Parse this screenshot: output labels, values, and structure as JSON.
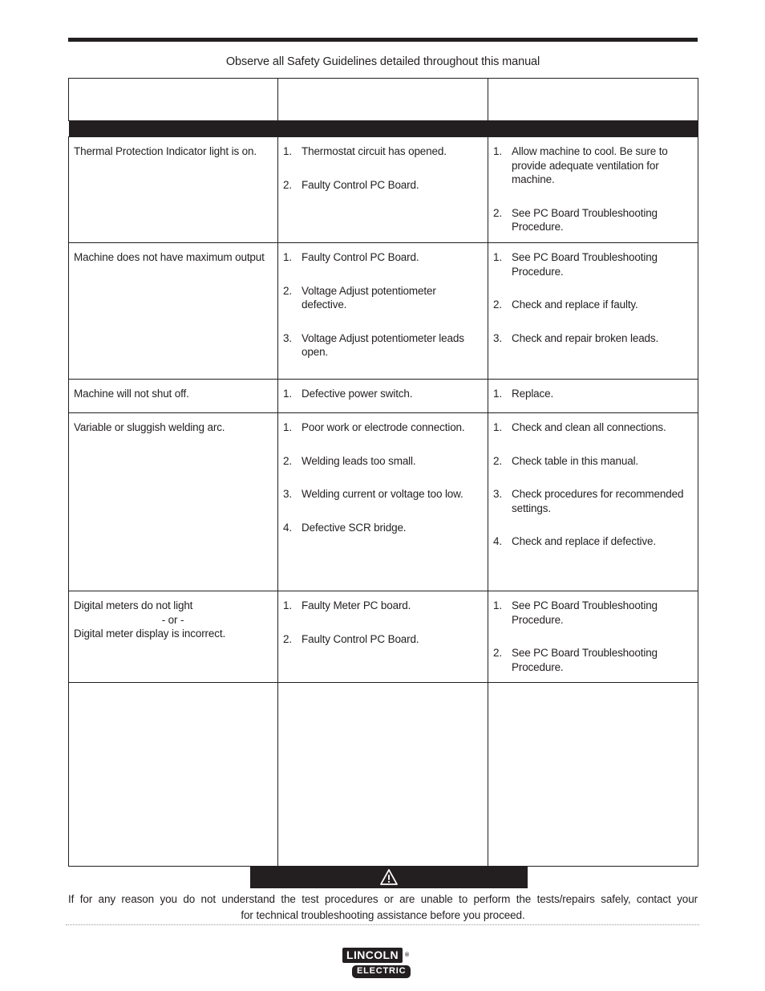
{
  "header": {
    "safety_note": "Observe all Safety Guidelines detailed throughout this manual"
  },
  "table": {
    "column_headers": [
      "",
      "",
      ""
    ],
    "rows": [
      {
        "symptom": "Thermal Protection Indicator light is on.",
        "possible_areas": [
          {
            "num": "1.",
            "text": "Thermostat circuit has opened."
          },
          {
            "num": "2.",
            "text": "Faulty Control PC Board."
          }
        ],
        "recommended_course": [
          {
            "num": "1.",
            "text": "Allow machine to cool.  Be sure to provide adequate ventilation for machine."
          },
          {
            "num": "2.",
            "text": "See PC Board Troubleshooting Procedure."
          }
        ]
      },
      {
        "symptom": "Machine does not have maximum output",
        "possible_areas": [
          {
            "num": "1.",
            "text": "Faulty Control PC Board."
          },
          {
            "num": "2.",
            "text": "Voltage Adjust potentiometer defective."
          },
          {
            "num": "3.",
            "text": "Voltage Adjust potentiometer leads open."
          }
        ],
        "recommended_course": [
          {
            "num": "1.",
            "text": "See PC Board Troubleshooting Procedure."
          },
          {
            "num": "2.",
            "text": "Check and replace if faulty."
          },
          {
            "num": "3.",
            "text": "Check and repair broken leads."
          }
        ]
      },
      {
        "symptom": "Machine will not shut off.",
        "possible_areas": [
          {
            "num": "1.",
            "text": "Defective power switch."
          }
        ],
        "recommended_course": [
          {
            "num": "1.",
            "text": "Replace."
          }
        ]
      },
      {
        "symptom": "Variable or sluggish welding arc.",
        "possible_areas": [
          {
            "num": "1.",
            "text": "Poor work or electrode connection."
          },
          {
            "num": "2.",
            "text": "Welding leads too small."
          },
          {
            "num": "3.",
            "text": "Welding current or voltage too low."
          },
          {
            "num": "4.",
            "text": "Defective SCR bridge."
          }
        ],
        "recommended_course": [
          {
            "num": "1.",
            "text": "Check and clean all connections."
          },
          {
            "num": "2.",
            "text": "Check table in this manual."
          },
          {
            "num": "3.",
            "text": "Check procedures for recommended settings."
          },
          {
            "num": "4.",
            "text": "Check and replace if defective."
          }
        ]
      },
      {
        "symptom_line1": "Digital meters do not light",
        "symptom_line2": "- or -",
        "symptom_line3": "Digital meter display is incorrect.",
        "possible_areas": [
          {
            "num": "1.",
            "text": "Faulty Meter PC board."
          },
          {
            "num": "2.",
            "text": "Faulty Control PC Board."
          }
        ],
        "recommended_course": [
          {
            "num": "1.",
            "text": "See PC Board Troubleshooting Procedure."
          },
          {
            "num": "2.",
            "text": "See PC Board Troubleshooting Procedure."
          }
        ]
      }
    ]
  },
  "warning": {
    "icon": "warning-triangle-icon",
    "line1": "If for any reason you do not understand the test procedures or are unable to perform the tests/repairs safely, contact your",
    "line2": "for technical troubleshooting assistance before you proceed."
  },
  "logo": {
    "word1": "LINCOLN",
    "registered": "®",
    "word2": "ELECTRIC"
  },
  "colors": {
    "ink": "#231f20",
    "paper": "#ffffff",
    "rule_dotted": "#9b9b9b"
  }
}
